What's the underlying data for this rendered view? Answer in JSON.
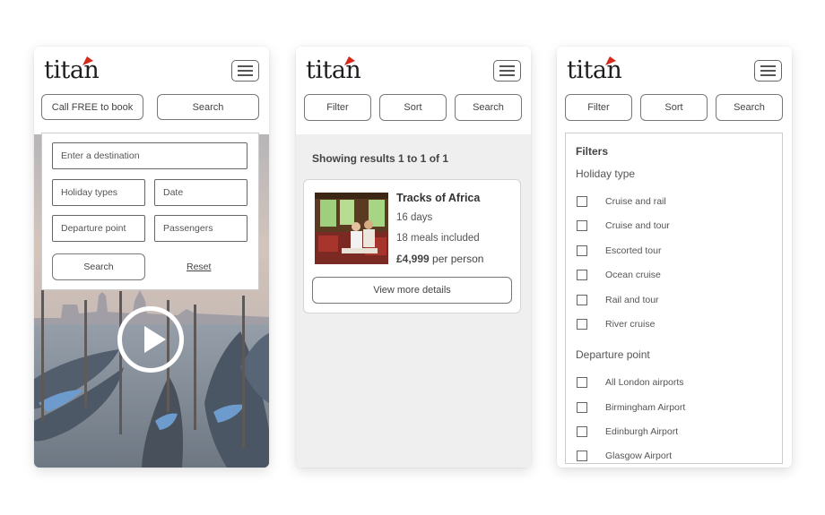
{
  "brand": {
    "logo_text": "titan"
  },
  "screen1": {
    "call_button": "Call FREE to book",
    "search_button": "Search",
    "form": {
      "destination_placeholder": "Enter a destination",
      "holiday_types": "Holiday types",
      "date": "Date",
      "departure_point": "Departure point",
      "passengers": "Passengers",
      "search": "Search",
      "reset": "Reset"
    }
  },
  "screen2": {
    "filter_button": "Filter",
    "sort_button": "Sort",
    "search_button": "Search",
    "results_summary": "Showing results 1 to 1 of 1",
    "result": {
      "title": "Tracks of Africa",
      "duration": "16 days",
      "meals": "18 meals included",
      "price": "£4,999",
      "price_suffix": "per person",
      "details_button": "View more details"
    }
  },
  "screen3": {
    "filter_button": "Filter",
    "sort_button": "Sort",
    "search_button": "Search",
    "filters_heading": "Filters",
    "holiday_type_heading": "Holiday type",
    "holiday_types": [
      "Cruise and rail",
      "Cruise and tour",
      "Escorted tour",
      "Ocean cruise",
      "Rail and tour",
      "River cruise"
    ],
    "departure_heading": "Departure point",
    "departure_points": [
      "All London airports",
      "Birmingham Airport",
      "Edinburgh Airport",
      "Glasgow Airport"
    ]
  },
  "colors": {
    "logo_flag_red": "#d42a1a",
    "logo_flag_orange": "#f0921e",
    "panel_grey": "#efefef",
    "border": "#777777"
  }
}
